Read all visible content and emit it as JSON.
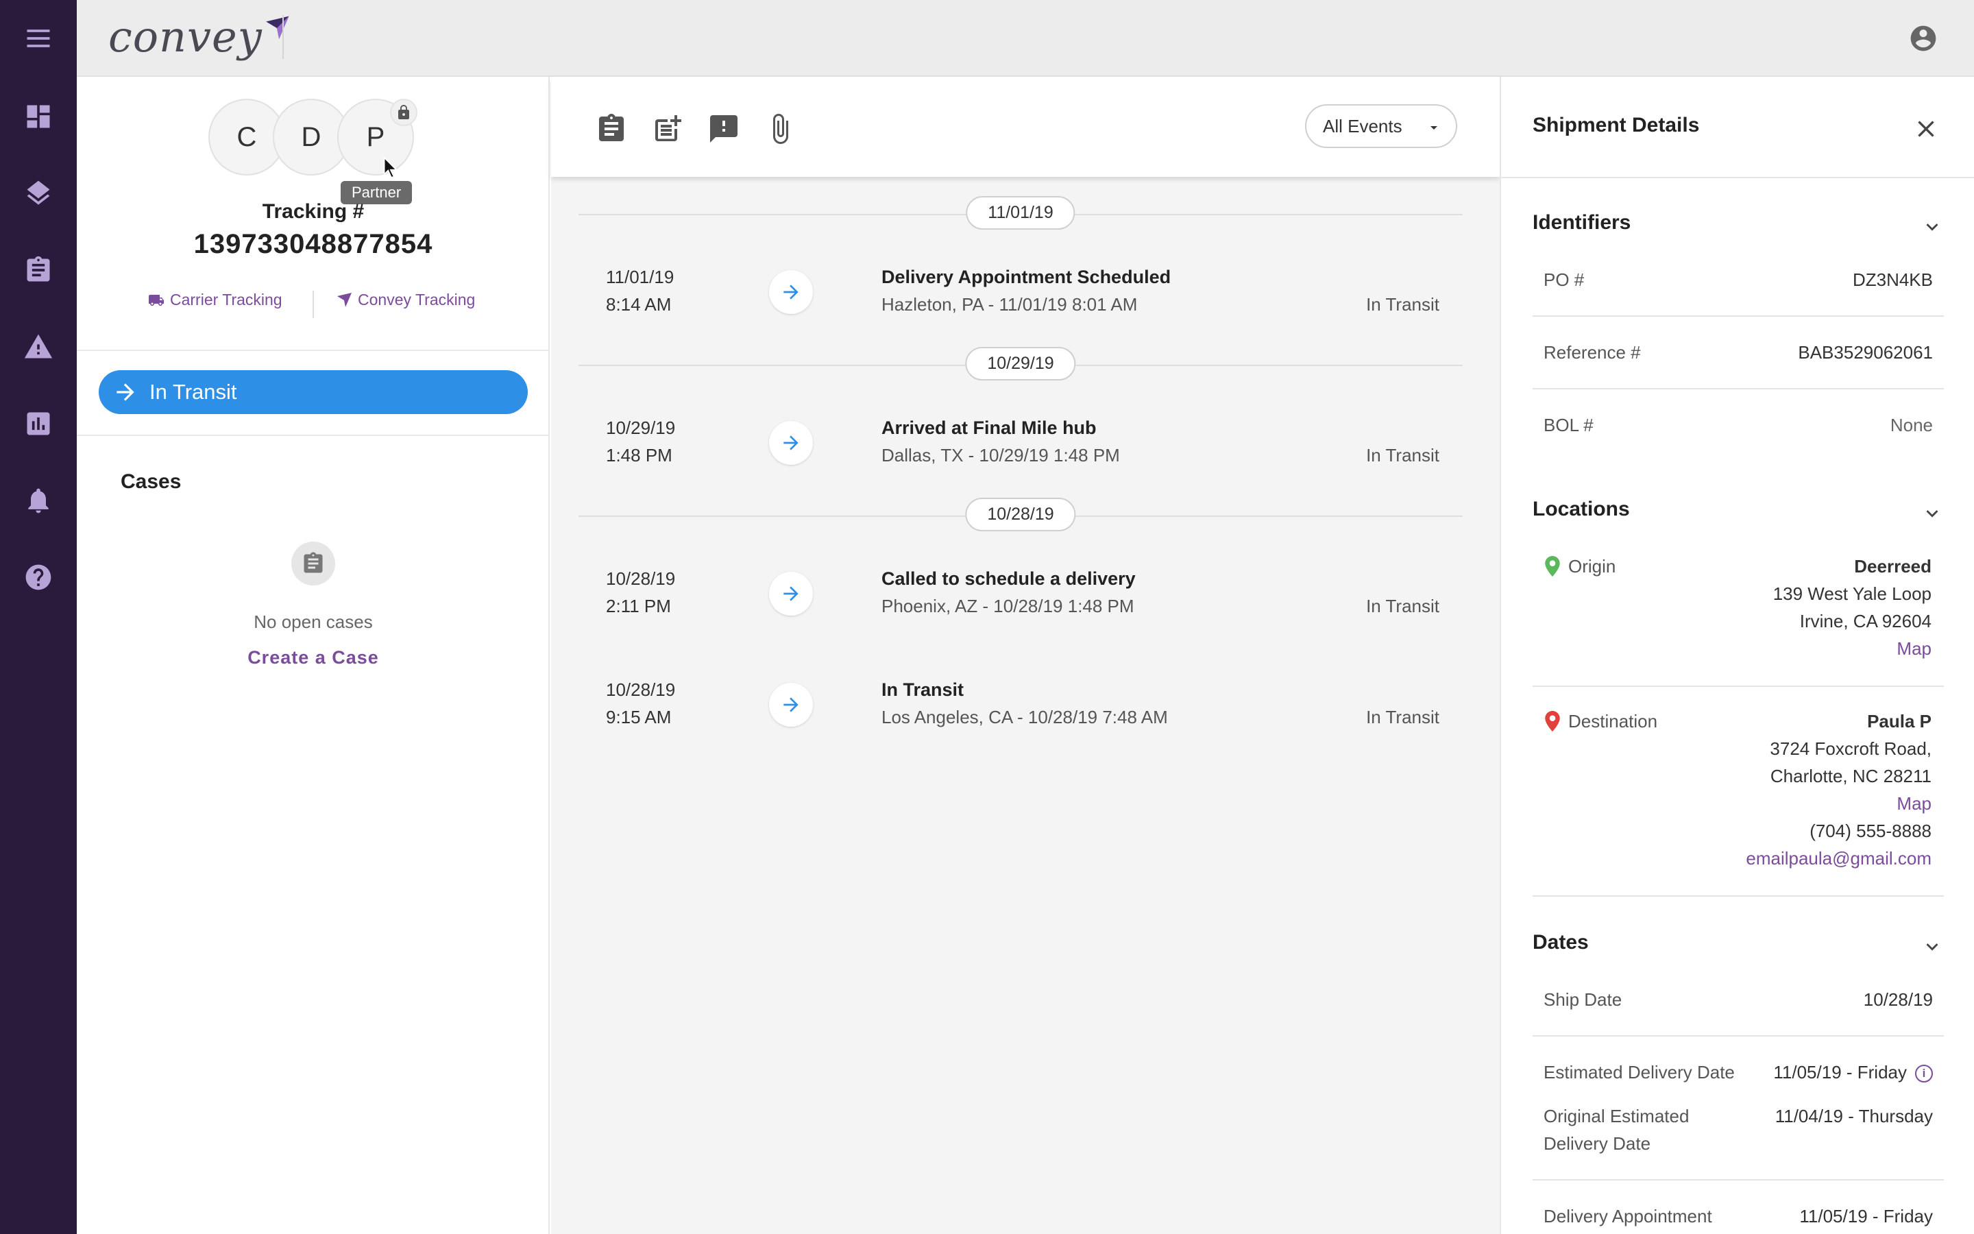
{
  "app": {
    "brand": "convey"
  },
  "tracking": {
    "partner_initials": [
      "C",
      "D",
      "P"
    ],
    "tooltip": "Partner",
    "label": "Tracking #",
    "number": "139733048877854",
    "carrier_link": "Carrier Tracking",
    "convey_link": "Convey Tracking",
    "status": "In Transit"
  },
  "cases": {
    "title": "Cases",
    "empty_text": "No open cases",
    "create_label": "Create a Case"
  },
  "events": {
    "filter_value": "All Events",
    "groups": [
      {
        "date": "11/01/19",
        "items": [
          {
            "date": "11/01/19",
            "time": "8:14 AM",
            "title": "Delivery Appointment Scheduled",
            "location": "Hazleton, PA - 11/01/19 8:01 AM",
            "status": "In Transit"
          }
        ]
      },
      {
        "date": "10/29/19",
        "items": [
          {
            "date": "10/29/19",
            "time": "1:48 PM",
            "title": "Arrived at Final Mile hub",
            "location": "Dallas, TX - 10/29/19 1:48 PM",
            "status": "In Transit"
          }
        ]
      },
      {
        "date": "10/28/19",
        "items": [
          {
            "date": "10/28/19",
            "time": "2:11 PM",
            "title": "Called to schedule a delivery",
            "location": "Phoenix, AZ - 10/28/19 1:48 PM",
            "status": "In Transit"
          },
          {
            "date": "10/28/19",
            "time": "9:15 AM",
            "title": "In Transit",
            "location": "Los Angeles, CA - 10/28/19 7:48 AM",
            "status": "In Transit"
          }
        ]
      }
    ]
  },
  "details": {
    "title": "Shipment Details",
    "identifiers": {
      "title": "Identifiers",
      "po_label": "PO #",
      "po_value": "DZ3N4KB",
      "ref_label": "Reference #",
      "ref_value": "BAB3529062061",
      "bol_label": "BOL #",
      "bol_value": "None"
    },
    "locations": {
      "title": "Locations",
      "origin_label": "Origin",
      "origin_name": "Deerreed",
      "origin_line1": "139 West Yale Loop",
      "origin_line2": "Irvine, CA 92604",
      "origin_map": "Map",
      "dest_label": "Destination",
      "dest_name": "Paula P",
      "dest_line1": "3724 Foxcroft Road,",
      "dest_line2": "Charlotte, NC 28211",
      "dest_map": "Map",
      "dest_phone": "(704) 555-8888",
      "dest_email": "emailpaula@gmail.com"
    },
    "dates": {
      "title": "Dates",
      "ship_label": "Ship Date",
      "ship_value": "10/28/19",
      "est_label": "Estimated Delivery Date",
      "est_value": "11/05/19 - Friday",
      "orig_label_1": "Original Estimated",
      "orig_label_2": "Delivery Date",
      "orig_value": "11/04/19 - Thursday",
      "appt_label": "Delivery Appointment",
      "appt_value": "11/05/19 - Friday"
    }
  },
  "colors": {
    "rail": "#2a1b3d",
    "accent_purple": "#7b4b9c",
    "status_blue": "#2d8fe6",
    "origin_pin": "#5cb85c",
    "destination_pin": "#e0413b"
  }
}
